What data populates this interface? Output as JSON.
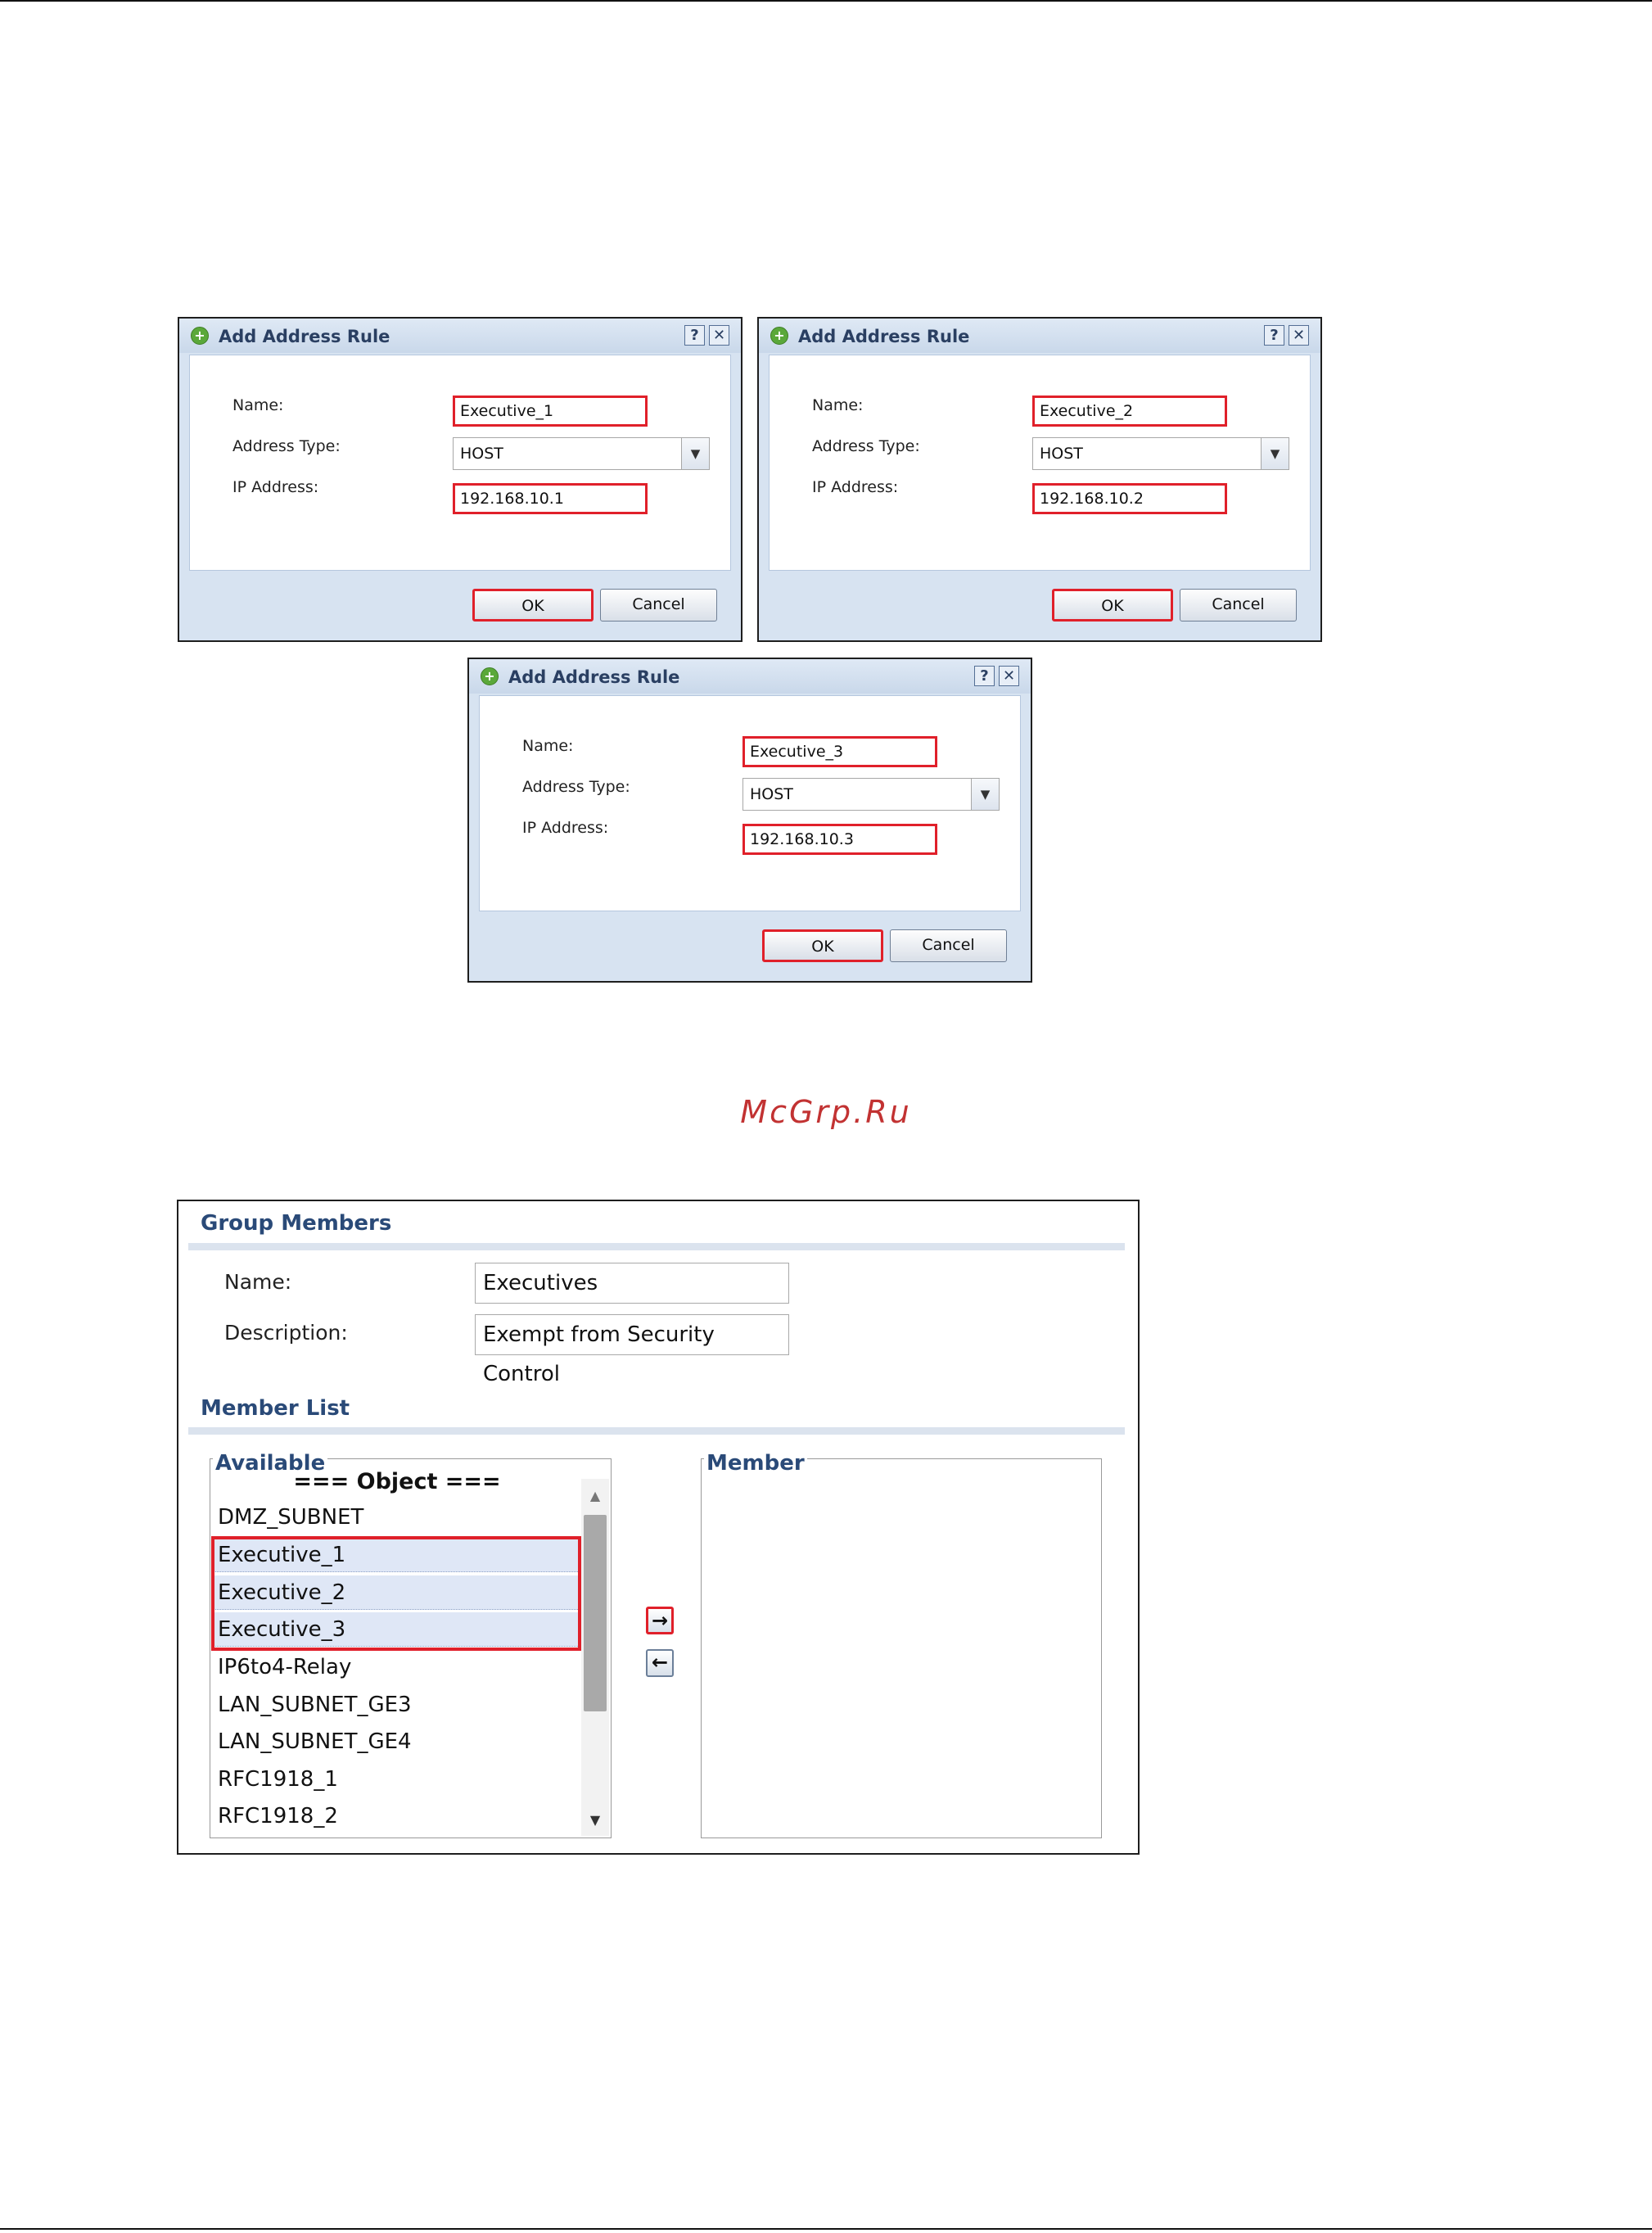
{
  "dialogs": [
    {
      "title": "Add Address Rule",
      "help_label": "?",
      "close_label": "✕",
      "name_label": "Name:",
      "type_label": "Address Type:",
      "ip_label": "IP Address:",
      "name_value": "Executive_1",
      "type_value": "HOST",
      "ip_value": "192.168.10.1",
      "ok_label": "OK",
      "cancel_label": "Cancel"
    },
    {
      "title": "Add Address Rule",
      "help_label": "?",
      "close_label": "✕",
      "name_label": "Name:",
      "type_label": "Address Type:",
      "ip_label": "IP Address:",
      "name_value": "Executive_2",
      "type_value": "HOST",
      "ip_value": "192.168.10.2",
      "ok_label": "OK",
      "cancel_label": "Cancel"
    },
    {
      "title": "Add Address Rule",
      "help_label": "?",
      "close_label": "✕",
      "name_label": "Name:",
      "type_label": "Address Type:",
      "ip_label": "IP Address:",
      "name_value": "Executive_3",
      "type_value": "HOST",
      "ip_value": "192.168.10.3",
      "ok_label": "OK",
      "cancel_label": "Cancel"
    }
  ],
  "watermark": "McGrp.Ru",
  "group": {
    "title": "Group Members",
    "name_label": "Name:",
    "name_value": "Executives",
    "description_label": "Description:",
    "description_value": "Exempt from Security Control",
    "member_list_title": "Member List",
    "available_label": "Available",
    "member_label": "Member",
    "list_header": "=== Object ===",
    "available_items": [
      {
        "label": "DMZ_SUBNET",
        "selected": false
      },
      {
        "label": "Executive_1",
        "selected": true
      },
      {
        "label": "Executive_2",
        "selected": true
      },
      {
        "label": "Executive_3",
        "selected": true
      },
      {
        "label": "IP6to4-Relay",
        "selected": false
      },
      {
        "label": "LAN_SUBNET_GE3",
        "selected": false
      },
      {
        "label": "LAN_SUBNET_GE4",
        "selected": false
      },
      {
        "label": "RFC1918_1",
        "selected": false
      },
      {
        "label": "RFC1918_2",
        "selected": false
      }
    ],
    "move_right_icon": "arrow-right-icon",
    "move_left_icon": "arrow-left-icon"
  },
  "colors": {
    "highlight_red": "#e0202a",
    "title_blue": "#2a4a78",
    "dialog_bg": "#d7e3f1",
    "watermark": "#c23232"
  }
}
